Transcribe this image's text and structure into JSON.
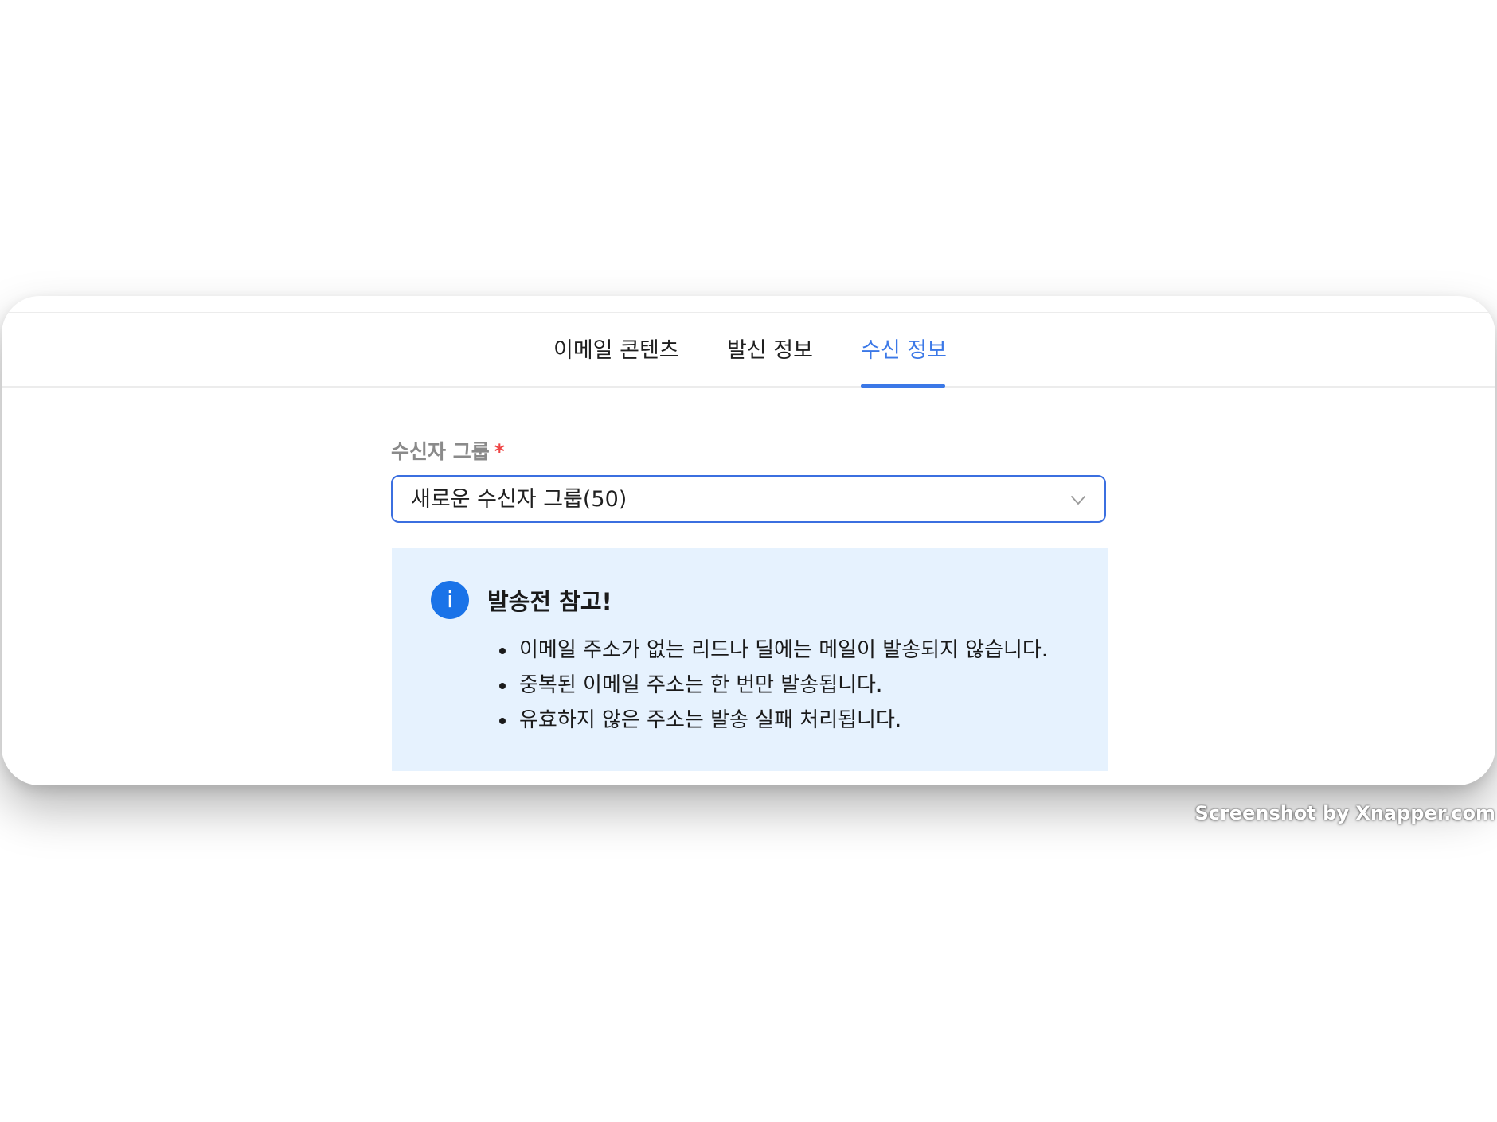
{
  "tabs": [
    {
      "label": "이메일 콘텐츠",
      "active": false
    },
    {
      "label": "발신 정보",
      "active": false
    },
    {
      "label": "수신 정보",
      "active": true
    }
  ],
  "form": {
    "recipient_group_label": "수신자 그룹",
    "required_mark": "*",
    "recipient_group_value": "새로운 수신자 그룹(50)"
  },
  "notice": {
    "icon": "info-icon",
    "icon_glyph": "i",
    "title": "발송전 참고!",
    "items": [
      "이메일 주소가 없는 리드나 딜에는 메일이 발송되지 않습니다.",
      "중복된 이메일 주소는 한 번만 발송됩니다.",
      "유효하지 않은 주소는 발송 실패 처리됩니다."
    ]
  },
  "watermark": "Screenshot by Xnapper.com",
  "colors": {
    "accent": "#3b78e7",
    "required": "#ef4444",
    "notice_bg": "#e6f2fe",
    "info_icon": "#1a73e8"
  }
}
